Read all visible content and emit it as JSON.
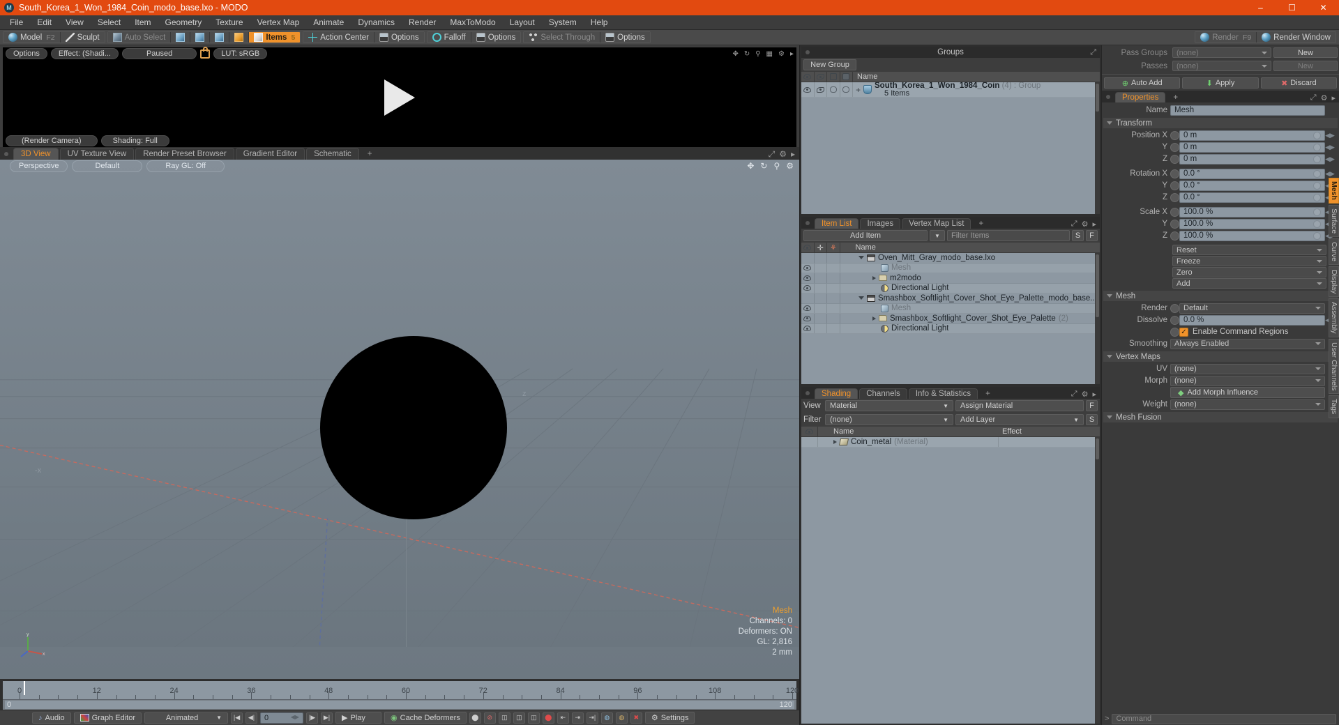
{
  "titlebar": {
    "title": "South_Korea_1_Won_1984_Coin_modo_base.lxo - MODO",
    "app_icon": "modo-icon",
    "minimize": "–",
    "maximize": "☐",
    "close": "✕"
  },
  "menubar": {
    "items": [
      "File",
      "Edit",
      "View",
      "Select",
      "Item",
      "Geometry",
      "Texture",
      "Vertex Map",
      "Animate",
      "Dynamics",
      "Render",
      "MaxToModo",
      "Layout",
      "System",
      "Help"
    ]
  },
  "modebar": {
    "group1": [
      {
        "label": "Model",
        "key": "F2",
        "icon": "sphere-icon",
        "active": false
      },
      {
        "label": "Sculpt",
        "key": "",
        "icon": "pen-icon",
        "active": false
      }
    ],
    "group2": [
      {
        "label": "Auto Select",
        "key": "",
        "icon": "cube-grey-icon",
        "dim": true
      },
      {
        "label": "",
        "key": "",
        "icon": "vertex-cube-icon",
        "dim": false
      },
      {
        "label": "",
        "key": "",
        "icon": "edge-cube-icon",
        "dim": false
      },
      {
        "label": "",
        "key": "",
        "icon": "polygon-cube-icon",
        "dim": false
      },
      {
        "label": "",
        "key": "",
        "icon": "material-cube-icon",
        "dim": false
      },
      {
        "label": "Items",
        "key": "5",
        "icon": "items-cube-icon",
        "active": true
      }
    ],
    "group3": [
      {
        "label": "Action Center",
        "icon": "action-center-icon"
      },
      {
        "label": "Options",
        "icon": "options-icon"
      }
    ],
    "group4": [
      {
        "label": "Falloff",
        "icon": "falloff-icon"
      },
      {
        "label": "Options",
        "icon": "options-icon"
      }
    ],
    "group5": [
      {
        "label": "Select Through",
        "icon": "select-through-icon",
        "dim": true
      },
      {
        "label": "Options",
        "icon": "options-icon"
      }
    ],
    "group6": [
      {
        "label": "Render",
        "key": "F9",
        "icon": "render-icon",
        "dim": true
      },
      {
        "label": "Render Window",
        "icon": "render-window-icon"
      }
    ]
  },
  "preview": {
    "buttons": [
      "Options",
      "Effect: (Shadi...",
      "Paused",
      "LUT: sRGB"
    ],
    "lock_icon": "unlock-icon",
    "play_glyph": "play-triangle",
    "hud_icons": [
      "move-icon",
      "rotate-icon",
      "zoom-icon",
      "grid-icon",
      "gear-icon",
      "chevron-right-icon"
    ]
  },
  "viewport_tabs": {
    "tabs": [
      "3D View",
      "UV Texture View",
      "Render Preset Browser",
      "Gradient Editor",
      "Schematic"
    ],
    "selected": "3D View",
    "add": "+",
    "right_icons": [
      "maximize-icon",
      "gear-icon",
      "chevron-right-icon"
    ]
  },
  "viewport": {
    "buttons": [
      "Perspective",
      "Default",
      "Ray GL: Off"
    ],
    "right_icons": [
      "move-icon",
      "rotate-icon",
      "zoom-icon",
      "gear-icon"
    ],
    "axis_labels": {
      "x": "x",
      "y": "y",
      "z": "z",
      "neg_x": "-x"
    },
    "hud": {
      "title": "Mesh",
      "channels": "Channels: 0",
      "deformers": "Deformers: ON",
      "gl": "GL: 2,816",
      "scale": "2 mm"
    }
  },
  "timeline": {
    "ticks": [
      {
        "value": "0",
        "pos": 0
      },
      {
        "value": "12",
        "pos": 12
      },
      {
        "value": "24",
        "pos": 24
      },
      {
        "value": "36",
        "pos": 36
      },
      {
        "value": "48",
        "pos": 48
      },
      {
        "value": "60",
        "pos": 60
      },
      {
        "value": "72",
        "pos": 72
      },
      {
        "value": "84",
        "pos": 84
      },
      {
        "value": "96",
        "pos": 96
      },
      {
        "value": "108",
        "pos": 108
      },
      {
        "value": "120",
        "pos": 120
      }
    ],
    "range_start": "0",
    "range_end": "120",
    "current_frame": 0
  },
  "bottombar": {
    "audio": "Audio",
    "graph_editor": "Graph Editor",
    "mode": "Animated",
    "frame_value": "0",
    "play": "Play",
    "cache_deformers": "Cache Deformers",
    "settings": "Settings",
    "transport_icons": [
      "first-frame-icon",
      "prev-key-icon",
      "next-key-icon",
      "last-frame-icon"
    ],
    "tool_icons": [
      "record-icon",
      "key-icon",
      "auto-key-icon",
      "ghost-icon",
      "snap-icon",
      "lock-icon",
      "light-icon",
      "material-icon",
      "delete-icon"
    ]
  },
  "groups_panel": {
    "title": "Groups",
    "new_group_button": "New Group",
    "columns": [
      "eye-icon",
      "render-icon",
      "wire-icon",
      "shaded-icon",
      "Name"
    ],
    "rows": [
      {
        "name": "South_Korea_1_Won_1984_Coin",
        "count": "(4)",
        "type": ": Group",
        "subtitle": "5 Items",
        "icon": "group-icon",
        "expander": "+"
      }
    ]
  },
  "item_list_panel": {
    "tabs": [
      "Item List",
      "Images",
      "Vertex Map List"
    ],
    "selected_tab": "Item List",
    "add": "+",
    "add_item_button": "Add Item",
    "filter_placeholder": "Filter Items",
    "btn_s": "S",
    "btn_f": "F",
    "columns": [
      "eye-icon",
      "lock-icon",
      "axis-icon",
      "Name"
    ],
    "rows": [
      {
        "name": "Oven_Mitt_Gray_modo_base.lxo",
        "indent": 0,
        "icon": "scene-icon",
        "expander": "down",
        "eye": false,
        "dim": false
      },
      {
        "name": "Mesh",
        "indent": 1,
        "icon": "mesh-icon",
        "expander": "none",
        "eye": true,
        "dim": true
      },
      {
        "name": "m2modo",
        "indent": 1,
        "icon": "folder-icon",
        "expander": "right",
        "eye": true,
        "dim": false
      },
      {
        "name": "Directional Light",
        "indent": 1,
        "icon": "light-icon",
        "expander": "none",
        "eye": true,
        "dim": false
      },
      {
        "name": "Smashbox_Softlight_Cover_Shot_Eye_Palette_modo_base...",
        "indent": 0,
        "icon": "scene-icon",
        "expander": "down",
        "eye": false,
        "dim": false
      },
      {
        "name": "Mesh",
        "indent": 1,
        "icon": "mesh-icon",
        "expander": "none",
        "eye": true,
        "dim": true
      },
      {
        "name": "Smashbox_Softlight_Cover_Shot_Eye_Palette",
        "count": "(2)",
        "indent": 1,
        "icon": "folder-icon",
        "expander": "right",
        "eye": true,
        "dim": false
      },
      {
        "name": "Directional Light",
        "indent": 1,
        "icon": "light-icon",
        "expander": "none",
        "eye": true,
        "dim": false
      }
    ]
  },
  "shading_panel": {
    "tabs": [
      "Shading",
      "Channels",
      "Info & Statistics"
    ],
    "selected_tab": "Shading",
    "add": "+",
    "view_label": "View",
    "view_value": "Material",
    "assign_material": "Assign Material",
    "btn_f": "F",
    "filter_label": "Filter",
    "filter_value": "(none)",
    "add_layer": "Add Layer",
    "btn_s": "S",
    "columns": [
      "eye-icon",
      "Name",
      "Effect"
    ],
    "rows": [
      {
        "name": "Coin_metal",
        "type": "(Material)",
        "effect": "",
        "icon": "material-icon",
        "expander": "right"
      }
    ]
  },
  "properties_top": {
    "pass_groups_label": "Pass Groups",
    "pass_groups_value": "(none)",
    "pass_groups_new": "New",
    "passes_label": "Passes",
    "passes_value": "(none)",
    "passes_new": "New",
    "auto_add": "Auto Add",
    "apply": "Apply",
    "discard": "Discard"
  },
  "properties": {
    "tab": "Properties",
    "add": "+",
    "name_label": "Name",
    "name_value": "Mesh",
    "sections": {
      "transform": "Transform",
      "mesh": "Mesh",
      "vertex_maps": "Vertex Maps",
      "mesh_fusion": "Mesh Fusion"
    },
    "transform": [
      {
        "label": "Position X",
        "value": "0 m"
      },
      {
        "label": "Y",
        "value": "0 m"
      },
      {
        "label": "Z",
        "value": "0 m"
      },
      {
        "label": "Rotation X",
        "value": "0.0 °"
      },
      {
        "label": "Y",
        "value": "0.0 °"
      },
      {
        "label": "Z",
        "value": "0.0 °"
      },
      {
        "label": "Scale X",
        "value": "100.0 %"
      },
      {
        "label": "Y",
        "value": "100.0 %"
      },
      {
        "label": "Z",
        "value": "100.0 %"
      }
    ],
    "transform_menus": [
      "Reset",
      "Freeze",
      "Zero",
      "Add"
    ],
    "mesh": {
      "render_label": "Render",
      "render_value": "Default",
      "dissolve_label": "Dissolve",
      "dissolve_value": "0.0 %",
      "enable_command_regions": "Enable Command Regions",
      "enable_command_regions_checked": true,
      "smoothing_label": "Smoothing",
      "smoothing_value": "Always Enabled"
    },
    "vertex_maps": {
      "uv_label": "UV",
      "uv_value": "(none)",
      "morph_label": "Morph",
      "morph_value": "(none)",
      "add_morph_influence": "Add Morph Influence",
      "weight_label": "Weight",
      "weight_value": "(none)"
    },
    "side_tabs": [
      "Mesh",
      "Surface",
      "Curve",
      "Display",
      "Assembly",
      "User Channels",
      "Tags"
    ],
    "side_tab_selected": "Mesh"
  },
  "command_bar": {
    "prompt": ">",
    "placeholder": "Command"
  },
  "colors": {
    "title_bar": "#e24a10",
    "accent": "#f0922b",
    "panel_bg": "#3d3d3d",
    "list_bg": "#8d98a2",
    "viewport_bg": "#757f89"
  }
}
